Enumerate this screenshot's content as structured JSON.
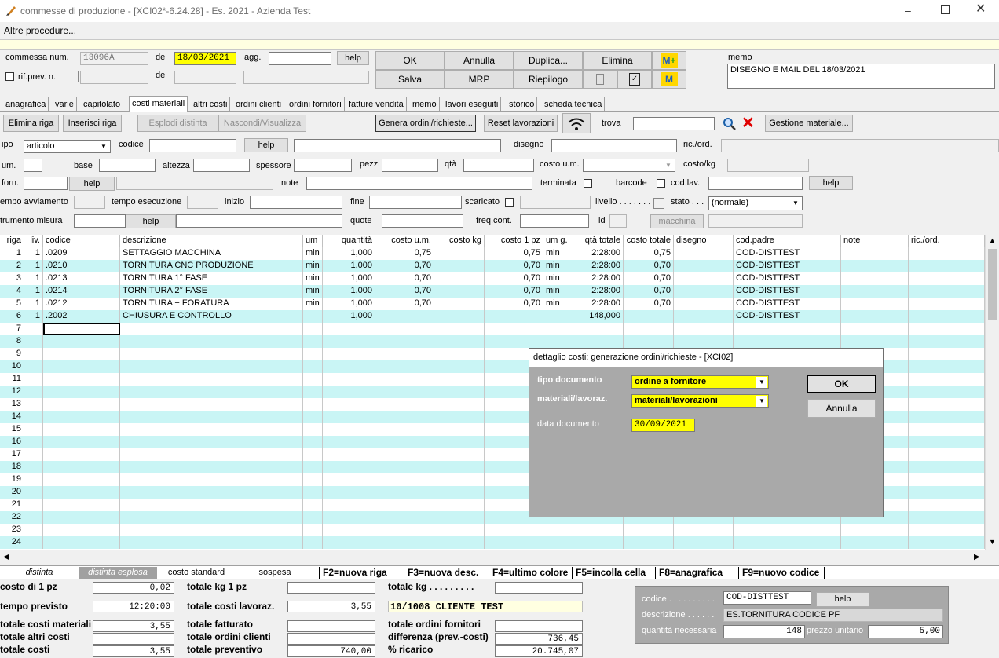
{
  "window": {
    "title": "commesse di produzione - [XCI02*-6.24.28] - Es. 2021 - Azienda Test",
    "menu": "Altre procedure..."
  },
  "header": {
    "commessa_label": "commessa num.",
    "commessa_value": "13096A",
    "del_label": "del",
    "del_value": "18/03/2021",
    "agg_label": "agg.",
    "help": "help",
    "rifprev_label": "rif.prev. n.",
    "del2_label": "del",
    "buttons": {
      "ok": "OK",
      "annulla": "Annulla",
      "duplica": "Duplica...",
      "elimina": "Elimina",
      "salva": "Salva",
      "mrp": "MRP",
      "riepilogo": "Riepilogo"
    },
    "memo_label": "memo",
    "memo_value": "DISEGNO E MAIL DEL 18/03/2021"
  },
  "tabs": [
    "anagrafica",
    "varie",
    "capitolato",
    "costi materiali",
    "altri costi",
    "ordini clienti",
    "ordini fornitori",
    "fatture vendita",
    "memo",
    "lavori eseguiti",
    "storico",
    "scheda tecnica"
  ],
  "toolbar": {
    "elimina_riga": "Elimina riga",
    "inserisci_riga": "Inserisci riga",
    "esplodi": "Esplodi distinta",
    "nascondi": "Nascondi/Visualizza",
    "genera": "Genera ordini/richieste...",
    "reset": "Reset lavorazioni",
    "trova": "trova",
    "gestione": "Gestione materiale..."
  },
  "form": {
    "tipo": "ipo",
    "tipo_value": "articolo",
    "codice": "codice",
    "help": "help",
    "disegno": "disegno",
    "ricord": "ric./ord.",
    "um": "um.",
    "base": "base",
    "altezza": "altezza",
    "spessore": "spessore",
    "pezzi": "pezzi",
    "qta": "qtà",
    "costoum": "costo u.m.",
    "costokg": "costo/kg",
    "forn": "forn.",
    "note": "note",
    "terminata": "terminata",
    "barcode": "barcode",
    "codlav": "cod.lav.",
    "tempo_avv": "empo avviamento",
    "tempo_es": "tempo esecuzione",
    "inizio": "inizio",
    "fine": "fine",
    "scaricato": "scaricato",
    "livello": "livello . . . . . . .",
    "stato": "stato . . .",
    "stato_value": "(normale)",
    "strumento": "trumento misura",
    "quote": "quote",
    "freqcont": "freq.cont.",
    "id": "id",
    "macchina": "macchina"
  },
  "grid": {
    "columns": [
      "riga",
      "liv.",
      "codice",
      "descrizione",
      "um",
      "quantità",
      "costo u.m.",
      "costo kg",
      "costo 1 pz",
      "um g.",
      "qtà totale",
      "costo totale",
      "disegno",
      "cod.padre",
      "note",
      "ric./ord."
    ],
    "rows": [
      [
        "1",
        "1",
        ".0209",
        "SETTAGGIO MACCHINA",
        "min",
        "1,000",
        "0,75",
        "",
        "0,75",
        "min",
        "2:28:00",
        "0,75",
        "",
        "COD-DISTTEST",
        "",
        ""
      ],
      [
        "2",
        "1",
        ".0210",
        "TORNITURA CNC PRODUZIONE",
        "min",
        "1,000",
        "0,70",
        "",
        "0,70",
        "min",
        "2:28:00",
        "0,70",
        "",
        "COD-DISTTEST",
        "",
        ""
      ],
      [
        "3",
        "1",
        ".0213",
        "TORNITURA 1° FASE",
        "min",
        "1,000",
        "0,70",
        "",
        "0,70",
        "min",
        "2:28:00",
        "0,70",
        "",
        "COD-DISTTEST",
        "",
        ""
      ],
      [
        "4",
        "1",
        ".0214",
        "TORNITURA 2° FASE",
        "min",
        "1,000",
        "0,70",
        "",
        "0,70",
        "min",
        "2:28:00",
        "0,70",
        "",
        "COD-DISTTEST",
        "",
        ""
      ],
      [
        "5",
        "1",
        ".0212",
        "TORNITURA + FORATURA",
        "min",
        "1,000",
        "0,70",
        "",
        "0,70",
        "min",
        "2:28:00",
        "0,70",
        "",
        "COD-DISTTEST",
        "",
        ""
      ],
      [
        "6",
        "1",
        ".2002",
        "CHIUSURA E CONTROLLO",
        "",
        "1,000",
        "",
        "",
        "",
        "",
        "148,000",
        "",
        "",
        "COD-DISTTEST",
        "",
        ""
      ]
    ],
    "empty_rows": [
      "7",
      "8",
      "9",
      "10",
      "11",
      "12",
      "13",
      "14",
      "15",
      "16",
      "17",
      "18",
      "19",
      "20",
      "21",
      "22",
      "23",
      "24"
    ]
  },
  "dialog": {
    "title": "dettaglio costi: generazione ordini/richieste - [XCI02]",
    "tipo_label": "tipo documento",
    "tipo_value": "ordine a fornitore",
    "mat_label": "materiali/lavoraz.",
    "mat_value": "materiali/lavorazioni",
    "data_label": "data documento",
    "data_value": "30/09/2021",
    "ok": "OK",
    "annulla": "Annulla"
  },
  "bottom_tabs": {
    "distinta": "distinta",
    "esplosa": "distinta esplosa",
    "standard": "costo standard",
    "sospesa": "sospesa"
  },
  "fkeys": [
    "F2=nuova riga",
    "F3=nuova desc.",
    "F4=ultimo colore",
    "F5=incolla cella",
    "F8=anagrafica",
    "F9=nuovo codice"
  ],
  "totals": {
    "costo1pz_l": "costo di 1 pz",
    "costo1pz": "0,02",
    "tempo_l": "tempo previsto",
    "tempo": "12:20:00",
    "tcm_l": "totale costi materiali",
    "tcm": "3,55",
    "tac_l": "totale altri costi",
    "tc_l": "totale costi",
    "tc": "3,55",
    "tkg1_l": "totale kg 1 pz",
    "tcl_l": "totale costi lavoraz.",
    "tcl": "3,55",
    "tf_l": "totale fatturato",
    "toc_l": "totale ordini clienti",
    "tp_l": "totale preventivo",
    "tp": "740,00",
    "tkg_l": "totale kg . . . . . . . . .",
    "cliente": "10/1008 CLIENTE TEST",
    "tof_l": "totale ordini fornitori",
    "diff_l": "differenza (prev.-costi)",
    "diff": "736,45",
    "ric_l": "% ricarico",
    "ric": "20.745,07"
  },
  "info": {
    "codice_l": "codice . . . . . . . . . .",
    "codice": "COD-DISTTEST",
    "help": "help",
    "descr_l": "descrizione . . . . . .",
    "descr": "ES.TORNITURA CODICE PF",
    "qta_l": "quantità necessaria",
    "qta": "148",
    "prezzo_l": "prezzo unitario",
    "prezzo": "5,00"
  }
}
